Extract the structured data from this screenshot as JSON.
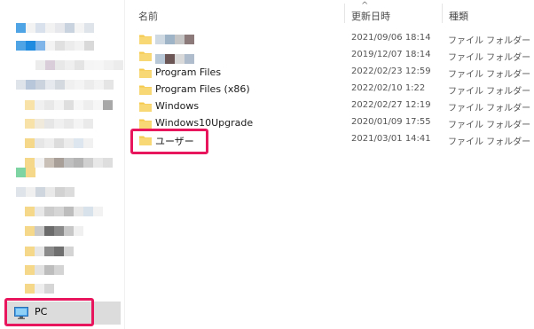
{
  "header": {
    "name_label": "名前",
    "date_label": "更新日時",
    "type_label": "種類",
    "sort_indicator": "^"
  },
  "files": [
    {
      "name": "",
      "date": "2021/09/06 18:14",
      "type": "ファイル フォルダー",
      "redacted": true
    },
    {
      "name": "",
      "date": "2019/12/07 18:14",
      "type": "ファイル フォルダー",
      "redacted": true
    },
    {
      "name": "Program Files",
      "date": "2022/02/23 12:59",
      "type": "ファイル フォルダー"
    },
    {
      "name": "Program Files (x86)",
      "date": "2022/02/10 1:22",
      "type": "ファイル フォルダー"
    },
    {
      "name": "Windows",
      "date": "2022/02/27 12:19",
      "type": "ファイル フォルダー"
    },
    {
      "name": "Windows10Upgrade",
      "date": "2020/01/09 17:55",
      "type": "ファイル フォルダー"
    },
    {
      "name": "ユーザー",
      "date": "2021/03/01 14:41",
      "type": "ファイル フォルダー"
    }
  ],
  "sidebar": {
    "pc_label": "PC",
    "pc_icon": "monitor-icon"
  },
  "colors": {
    "highlight": "#e8175d",
    "folder": "#f5c94c",
    "selected_bg": "#dcdcdc"
  }
}
